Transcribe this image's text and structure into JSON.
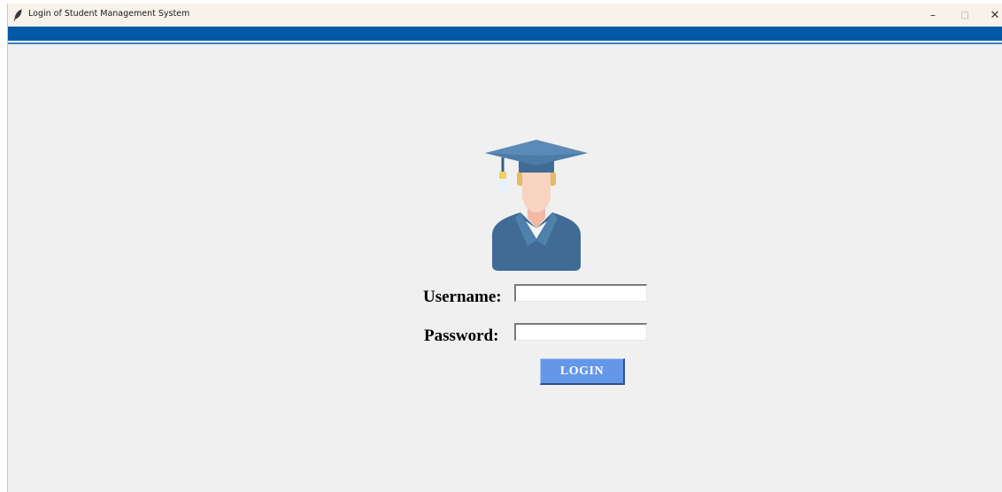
{
  "window": {
    "title": "Login of Student Management System",
    "icon": "feather-icon",
    "controls": {
      "minimize": "–",
      "maximize": "□",
      "close": "✕"
    }
  },
  "colors": {
    "header_bar": "#0158a6",
    "login_button": "#6497e8",
    "background": "#f0f0f0"
  },
  "login": {
    "avatar_icon": "graduate-student-icon",
    "username_label": "Username:",
    "username_value": "",
    "password_label": "Password:",
    "password_value": "",
    "button_label": "LOGIN"
  }
}
